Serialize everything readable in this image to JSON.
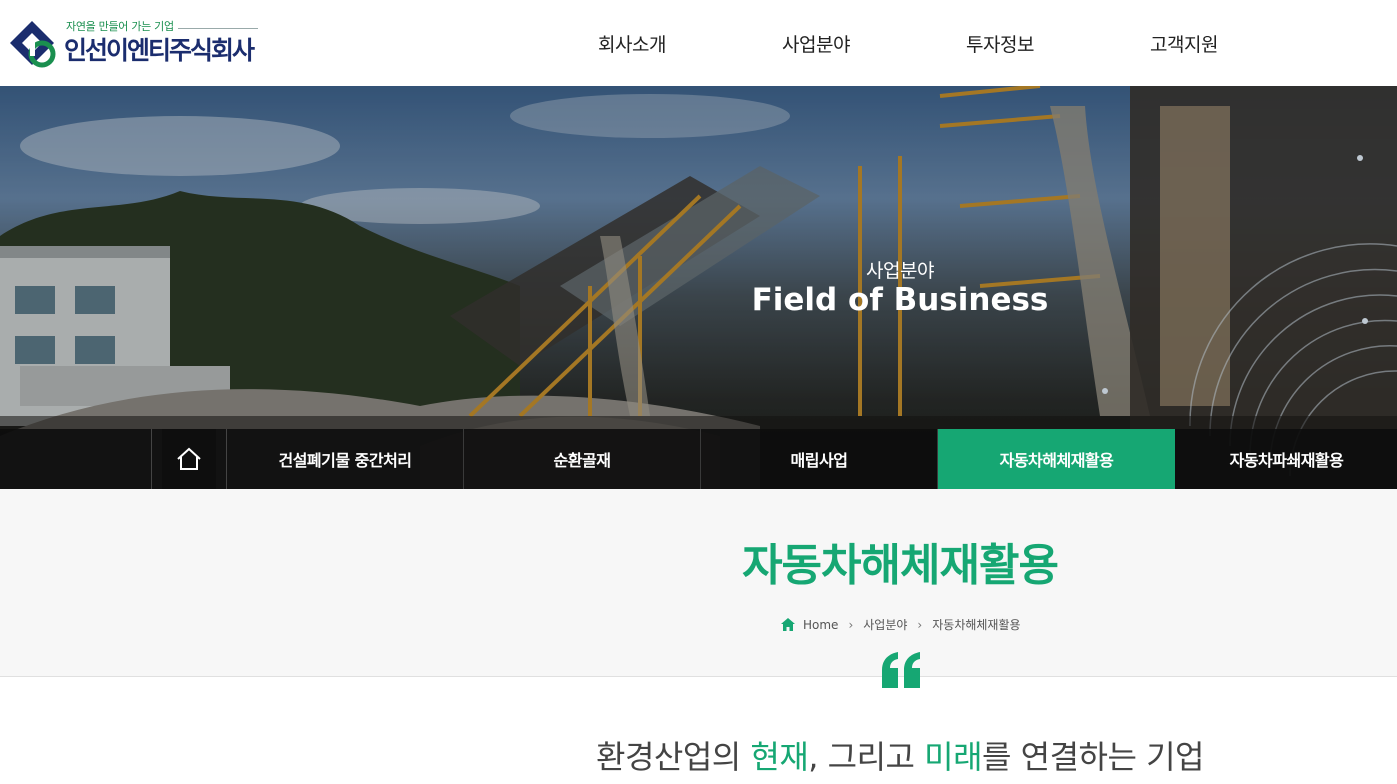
{
  "header": {
    "logo_tagline": "자연을 만들어 가는 기업",
    "logo_name": "인선이엔티주식회사",
    "nav": [
      "회사소개",
      "사업분야",
      "투자정보",
      "고객지원"
    ]
  },
  "hero": {
    "subtitle": "사업분야",
    "title": "Field of Business"
  },
  "subnav": {
    "home_icon": "home-icon",
    "items": [
      "건설폐기물 중간처리",
      "순환골재",
      "매립사업",
      "자동차해체재활용",
      "자동차파쇄재활용"
    ],
    "active_index": 3
  },
  "page": {
    "title": "자동차해체재활용",
    "breadcrumb": [
      "Home",
      "사업분야",
      "자동차해체재활용"
    ]
  },
  "slogan": {
    "part1": "환경산업의 ",
    "highlight1": "현재",
    "part2": ", 그리고 ",
    "highlight2": "미래",
    "part3": "를 연결하는 기업"
  },
  "colors": {
    "accent": "#16a773",
    "logo_navy": "#1b2d6e",
    "logo_green": "#1a8f4f"
  }
}
